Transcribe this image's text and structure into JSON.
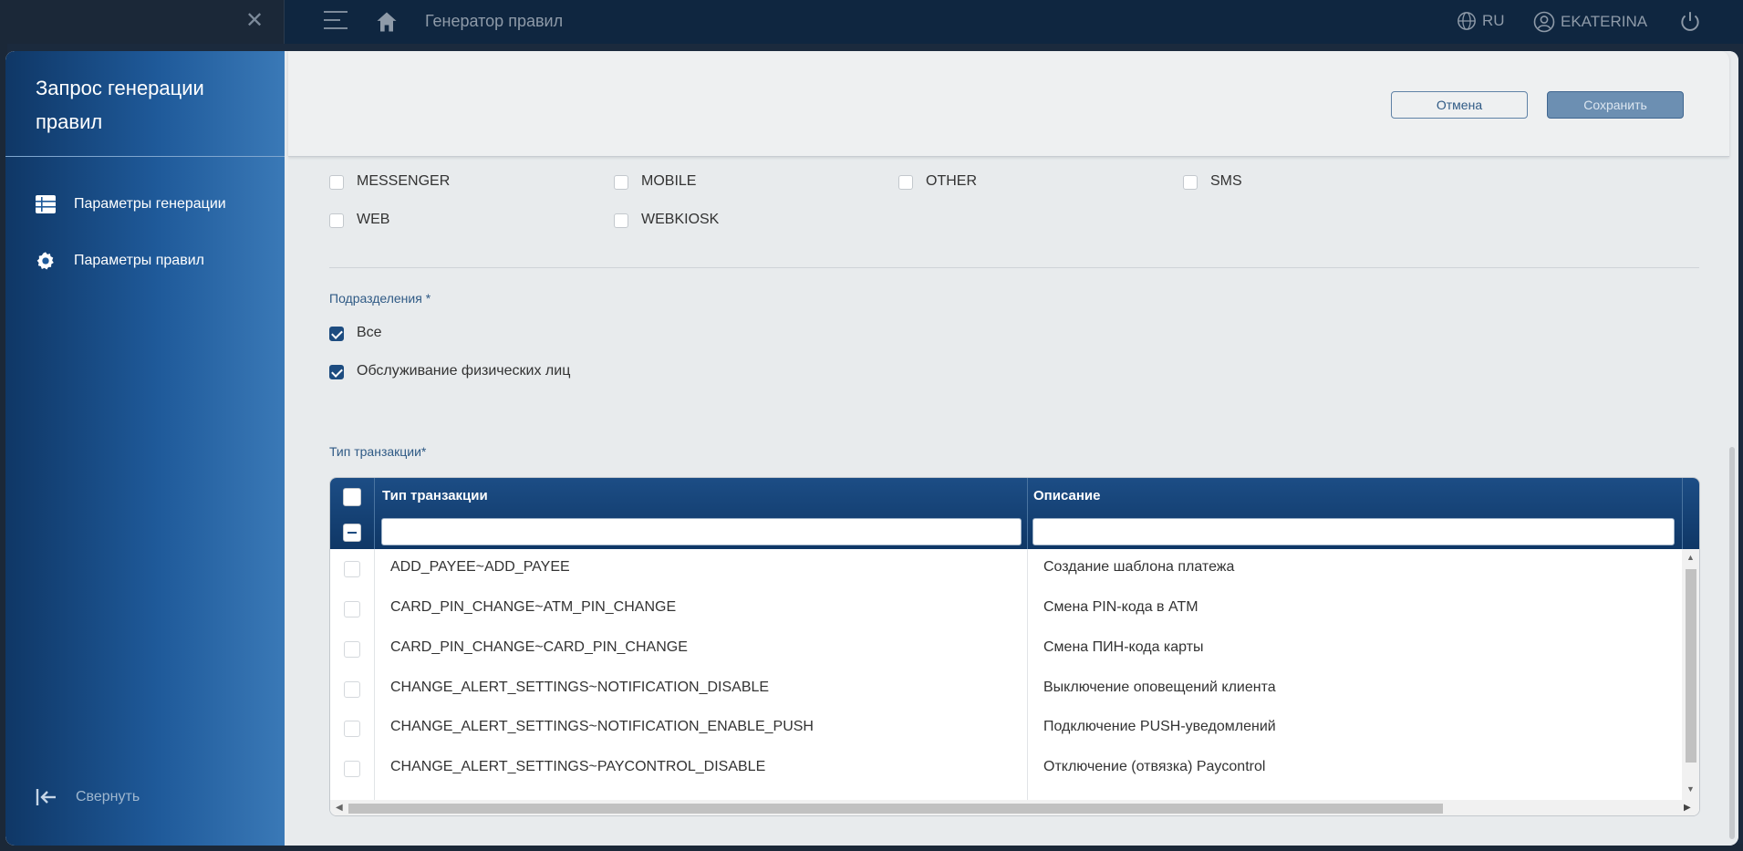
{
  "topbar": {
    "title": "Генератор правил",
    "lang": "RU",
    "user": "EKATERINA"
  },
  "sidebar": {
    "title": "Запрос генерации правил",
    "items": [
      {
        "label": "Параметры генерации",
        "icon": "table-icon"
      },
      {
        "label": "Параметры правил",
        "icon": "gear-icon"
      }
    ],
    "collapse_label": "Свернуть"
  },
  "actions": {
    "cancel_label": "Отмена",
    "save_label": "Сохранить"
  },
  "channels": [
    "MESSENGER",
    "MOBILE",
    "OTHER",
    "SMS",
    "WEB",
    "WEBKIOSK"
  ],
  "divisions": {
    "label": "Подразделения *",
    "options": [
      {
        "label": "Все",
        "checked": true
      },
      {
        "label": "Обслуживание физических лиц",
        "checked": true
      }
    ]
  },
  "transactions": {
    "label": "Тип транзакции*",
    "columns": [
      "Тип транзакции",
      "Описание"
    ],
    "rows": [
      {
        "type": "ADD_PAYEE~ADD_PAYEE",
        "desc": "Создание шаблона платежа"
      },
      {
        "type": "CARD_PIN_CHANGE~ATM_PIN_CHANGE",
        "desc": "Смена PIN-кода в ATM"
      },
      {
        "type": "CARD_PIN_CHANGE~CARD_PIN_CHANGE",
        "desc": "Смена ПИН-кода карты"
      },
      {
        "type": "CHANGE_ALERT_SETTINGS~NOTIFICATION_DISABLE",
        "desc": "Выключение оповещений клиента"
      },
      {
        "type": "CHANGE_ALERT_SETTINGS~NOTIFICATION_ENABLE_PUSH",
        "desc": "Подключение PUSH-уведомлений"
      },
      {
        "type": "CHANGE_ALERT_SETTINGS~PAYCONTROL_DISABLE",
        "desc": "Отключение (отвязка) Paycontrol"
      }
    ]
  },
  "colors": {
    "primary": "#0f3766",
    "accent": "#1d4c80",
    "background": "#e8ebed"
  }
}
